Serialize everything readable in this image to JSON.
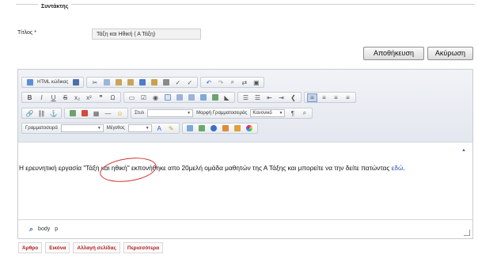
{
  "section": {
    "legend": "Συντάκτης"
  },
  "title_field": {
    "label": "Τίτλος *",
    "value": "Τάξη και Ηθική ( Α Τάξη)"
  },
  "buttons": {
    "save": "Αποθήκευση",
    "cancel": "Ακύρωση"
  },
  "toolbar": {
    "html_code": "HTML κώδικας",
    "style_label": "Στυλ",
    "format_label": "Μορφή Γραμματοσειράς",
    "format_value": "Κανονικό",
    "font_label": "Γραμματοσειρά",
    "size_label": "Μέγεθος",
    "bold": "B",
    "italic": "I",
    "underline": "U",
    "strike": "S",
    "subscript": "x₂",
    "superscript": "x²",
    "blockquote": "❞",
    "omega": "Ω",
    "paragraph_marks": "¶"
  },
  "content": {
    "text": "Η ερευνητική εργασία \"Τάξη και ηθική\" εκπονήθηκε απο 20μελή ομάδα μαθητών της Α Τάξης και μπορείτε να την δείτε πατώντας ",
    "link": "εδώ",
    "end": "."
  },
  "status": {
    "path_body": "body",
    "path_p": "p"
  },
  "tabs": [
    "Άρθρο",
    "Εικόνα",
    "Αλλαγή σελίδας",
    "Περισσότερα"
  ],
  "colors": {
    "annotation": "#d0312d",
    "link": "#2a4fc0",
    "tab_text": "#b21e1e"
  }
}
